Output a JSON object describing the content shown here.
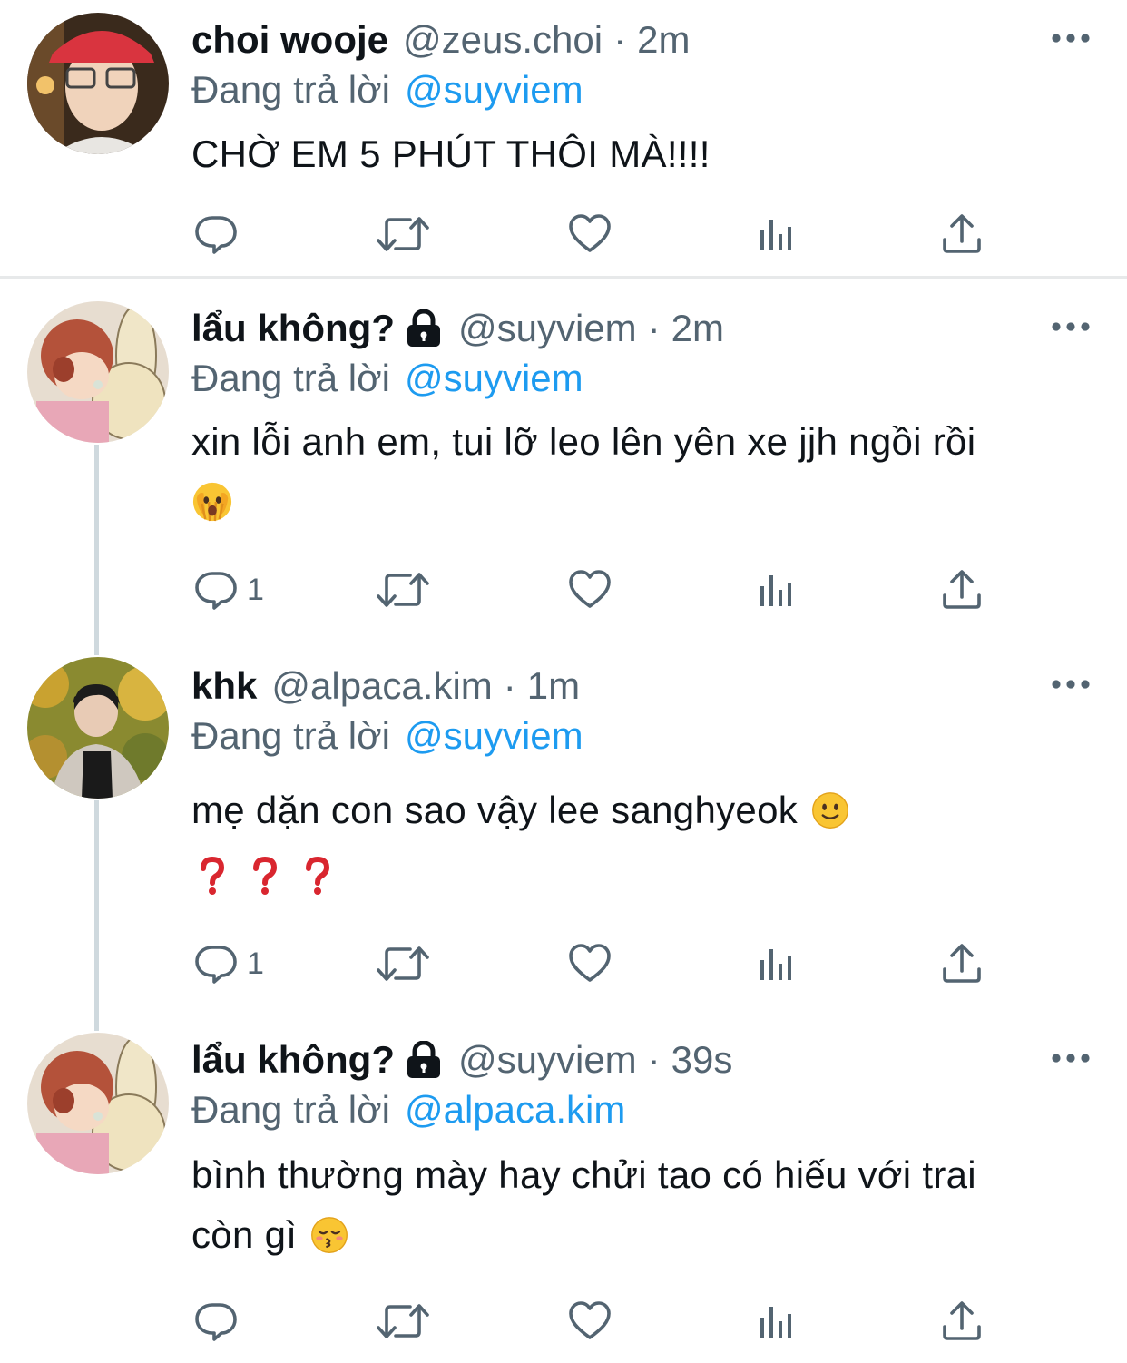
{
  "tweets": [
    {
      "name": "choi wooje",
      "locked": false,
      "handle": "@zeus.choi",
      "time": "2m",
      "reply_prefix": "Đang trả lời",
      "reply_to": "@suyviem",
      "text": "CHỜ EM 5 PHÚT THÔI MÀ!!!!",
      "reply_count": "",
      "avatar": "person-red-cap"
    },
    {
      "name": "lẩu không?",
      "locked": true,
      "handle": "@suyviem",
      "time": "2m",
      "reply_prefix": "Đang trả lời",
      "reply_to": "@suyviem",
      "text": "xin lỗi anh em, tui lỡ leo lên yên xe jjh ngồi rồi",
      "emoji": "face-with-open-eyes-and-hand-over-mouth",
      "reply_count": "1",
      "avatar": "cartoon-girl-and-rabbit"
    },
    {
      "name": "khk",
      "locked": false,
      "handle": "@alpaca.kim",
      "time": "1m",
      "reply_prefix": "Đang trả lời",
      "reply_to": "@suyviem",
      "text": "mẹ dặn con sao vậy lee sanghyeok",
      "emoji": "slightly-smiling-face",
      "extra_line": "❓❓❓",
      "reply_count": "1",
      "avatar": "person-autumn-trees"
    },
    {
      "name": "lẩu không?",
      "locked": true,
      "handle": "@suyviem",
      "time": "39s",
      "reply_prefix": "Đang trả lời",
      "reply_to": "@alpaca.kim",
      "text_line1": "bình thường mày hay chửi tao có hiếu với trai",
      "text_line2": "còn gì",
      "emoji": "kissing-face-with-closed-eyes",
      "reply_count": "",
      "avatar": "cartoon-girl-and-rabbit"
    }
  ],
  "separator": "·",
  "colors": {
    "text": "#0f1419",
    "secondary": "#536471",
    "link": "#1d9bf0",
    "divider": "#e7e9ea",
    "thread_line": "#cfd9de"
  },
  "icons": {
    "actions": [
      "reply-icon",
      "retweet-icon",
      "like-icon",
      "analytics-icon",
      "share-icon"
    ],
    "menu": "more-options-icon",
    "lock": "lock-icon"
  }
}
